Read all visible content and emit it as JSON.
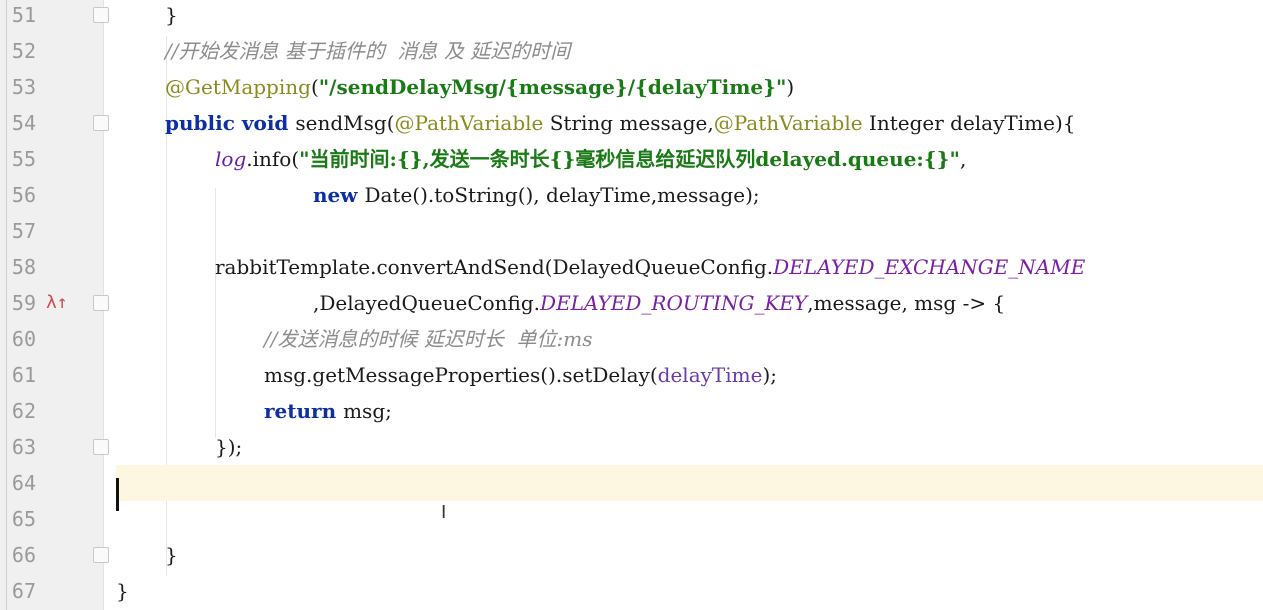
{
  "editor": {
    "lines": [
      {
        "n": "51",
        "parts": [
          {
            "t": "}",
            "c": ""
          }
        ]
      },
      {
        "n": "52",
        "parts": [
          {
            "t": "//开始发消息 基于插件的  消息 及 延迟的时间",
            "c": "cmt"
          }
        ]
      },
      {
        "n": "53",
        "parts": [
          {
            "t": "@GetMapping",
            "c": "ann"
          },
          {
            "t": "(",
            "c": ""
          },
          {
            "t": "\"/sendDelayMsg/{message}/{delayTime}\"",
            "c": "str"
          },
          {
            "t": ")",
            "c": ""
          }
        ]
      },
      {
        "n": "54",
        "parts": [
          {
            "t": "public ",
            "c": "kw"
          },
          {
            "t": "void ",
            "c": "kw"
          },
          {
            "t": "sendMsg(",
            "c": ""
          },
          {
            "t": "@PathVariable",
            "c": "ann"
          },
          {
            "t": " String message,",
            "c": ""
          },
          {
            "t": "@PathVariable",
            "c": "ann"
          },
          {
            "t": " Integer delayTime){",
            "c": ""
          }
        ]
      },
      {
        "n": "55",
        "parts": [
          {
            "t": "log",
            "c": "logv"
          },
          {
            "t": ".info(",
            "c": ""
          },
          {
            "t": "\"当前时间:{},发送一条时长{}毫秒信息给延迟队列delayed.queue:{}\"",
            "c": "str"
          },
          {
            "t": ",",
            "c": ""
          }
        ]
      },
      {
        "n": "56",
        "parts": [
          {
            "t": "new ",
            "c": "kw"
          },
          {
            "t": "Date().toString(), delayTime,message);",
            "c": ""
          }
        ]
      },
      {
        "n": "57",
        "parts": []
      },
      {
        "n": "58",
        "parts": [
          {
            "t": "rabbitTemplate.convertAndSend(DelayedQueueConfig.",
            "c": ""
          },
          {
            "t": "DELAYED_EXCHANGE_NAME",
            "c": "const"
          }
        ]
      },
      {
        "n": "59",
        "parts": [
          {
            "t": ",DelayedQueueConfig.",
            "c": ""
          },
          {
            "t": "DELAYED_ROUTING_KEY",
            "c": "const"
          },
          {
            "t": ",message, msg -> {",
            "c": ""
          }
        ]
      },
      {
        "n": "60",
        "parts": [
          {
            "t": "//发送消息的时候 延迟时长  单位:ms",
            "c": "cmt"
          }
        ]
      },
      {
        "n": "61",
        "parts": [
          {
            "t": "msg.getMessageProperties().setDelay(",
            "c": ""
          },
          {
            "t": "delayTime",
            "c": "param"
          },
          {
            "t": ");",
            "c": ""
          }
        ]
      },
      {
        "n": "62",
        "parts": [
          {
            "t": "return ",
            "c": "kw"
          },
          {
            "t": "msg;",
            "c": ""
          }
        ]
      },
      {
        "n": "63",
        "parts": [
          {
            "t": "});",
            "c": ""
          }
        ]
      },
      {
        "n": "64",
        "parts": []
      },
      {
        "n": "65",
        "parts": []
      },
      {
        "n": "66",
        "parts": [
          {
            "t": "}",
            "c": ""
          }
        ]
      },
      {
        "n": "67",
        "parts": [
          {
            "t": "}",
            "c": ""
          }
        ]
      }
    ],
    "current_line": "64",
    "gutter_marker": "λ↑",
    "gutter_marker_icon": "lambda-override-up-icon"
  }
}
